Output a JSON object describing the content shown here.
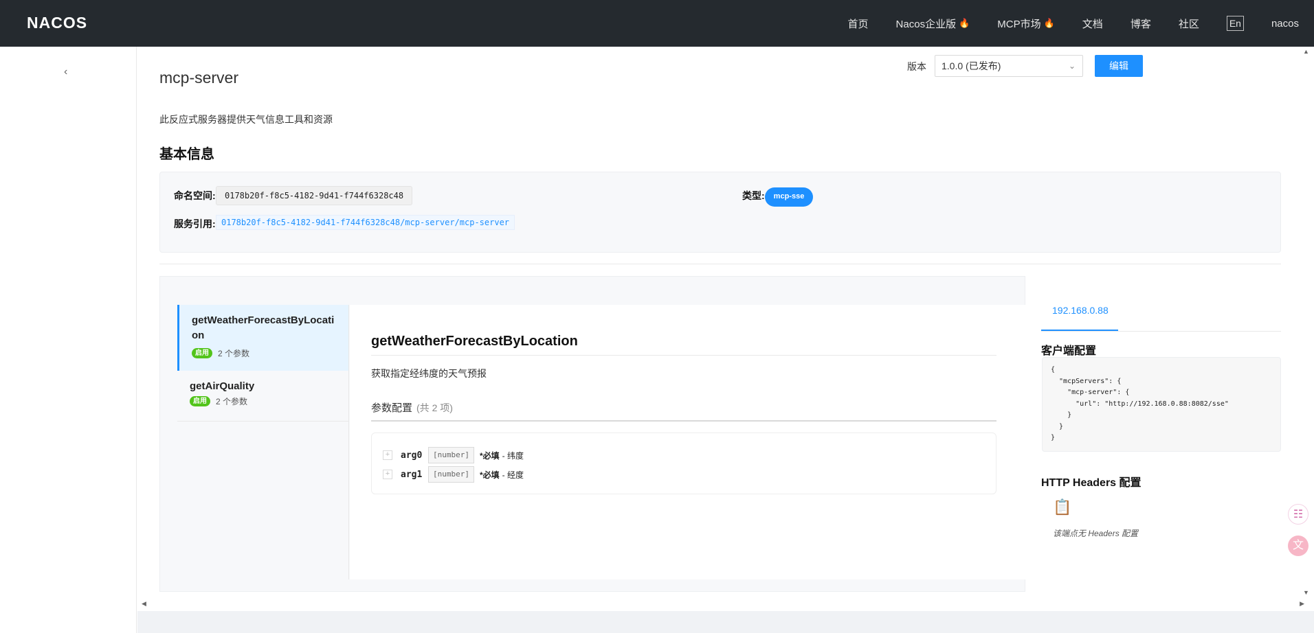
{
  "header": {
    "logo": "NACOS",
    "nav": [
      "首页",
      "Nacos企业版",
      "MCP市场",
      "文档",
      "博客",
      "社区"
    ],
    "lang": "En",
    "user": "nacos"
  },
  "page": {
    "title": "mcp-server",
    "description": "此反应式服务器提供天气信息工具和资源",
    "version_label": "版本",
    "version_value": "1.0.0 (已发布)",
    "edit_label": "编辑"
  },
  "basic": {
    "section_title": "基本信息",
    "namespace_label": "命名空间:",
    "namespace_value": "0178b20f-f8c5-4182-9d41-f744f6328c48",
    "ref_label": "服务引用:",
    "ref_value": "0178b20f-f8c5-4182-9d41-f744f6328c48/mcp-server/mcp-server",
    "type_label": "类型:",
    "type_value": "mcp-sse"
  },
  "tools": {
    "list": [
      {
        "name": "getWeatherForecastByLocation",
        "status": "启用",
        "params": "2 个参数"
      },
      {
        "name": "getAirQuality",
        "status": "启用",
        "params": "2 个参数"
      }
    ],
    "selected": {
      "title": "getWeatherForecastByLocation",
      "description": "获取指定经纬度的天气预报",
      "param_header": "参数配置",
      "param_count": "(共 2 项)",
      "params": [
        {
          "name": "arg0",
          "type": "[number]",
          "required": "*必填",
          "desc": "- 纬度"
        },
        {
          "name": "arg1",
          "type": "[number]",
          "required": "*必填",
          "desc": "- 经度"
        }
      ]
    }
  },
  "endpoint": {
    "ip": "192.168.0.88",
    "client_config_title": "客户端配置",
    "client_config_code": "{\n  \"mcpServers\": {\n    \"mcp-server\": {\n      \"url\": \"http://192.168.0.88:8082/sse\"\n    }\n  }\n}",
    "headers_title": "HTTP Headers 配置",
    "headers_empty": "该端点无 Headers 配置"
  },
  "colors": {
    "accent": "#1e90ff",
    "topbar": "#252a2f",
    "enabled": "#52c41a",
    "fire": "#e8473b"
  }
}
